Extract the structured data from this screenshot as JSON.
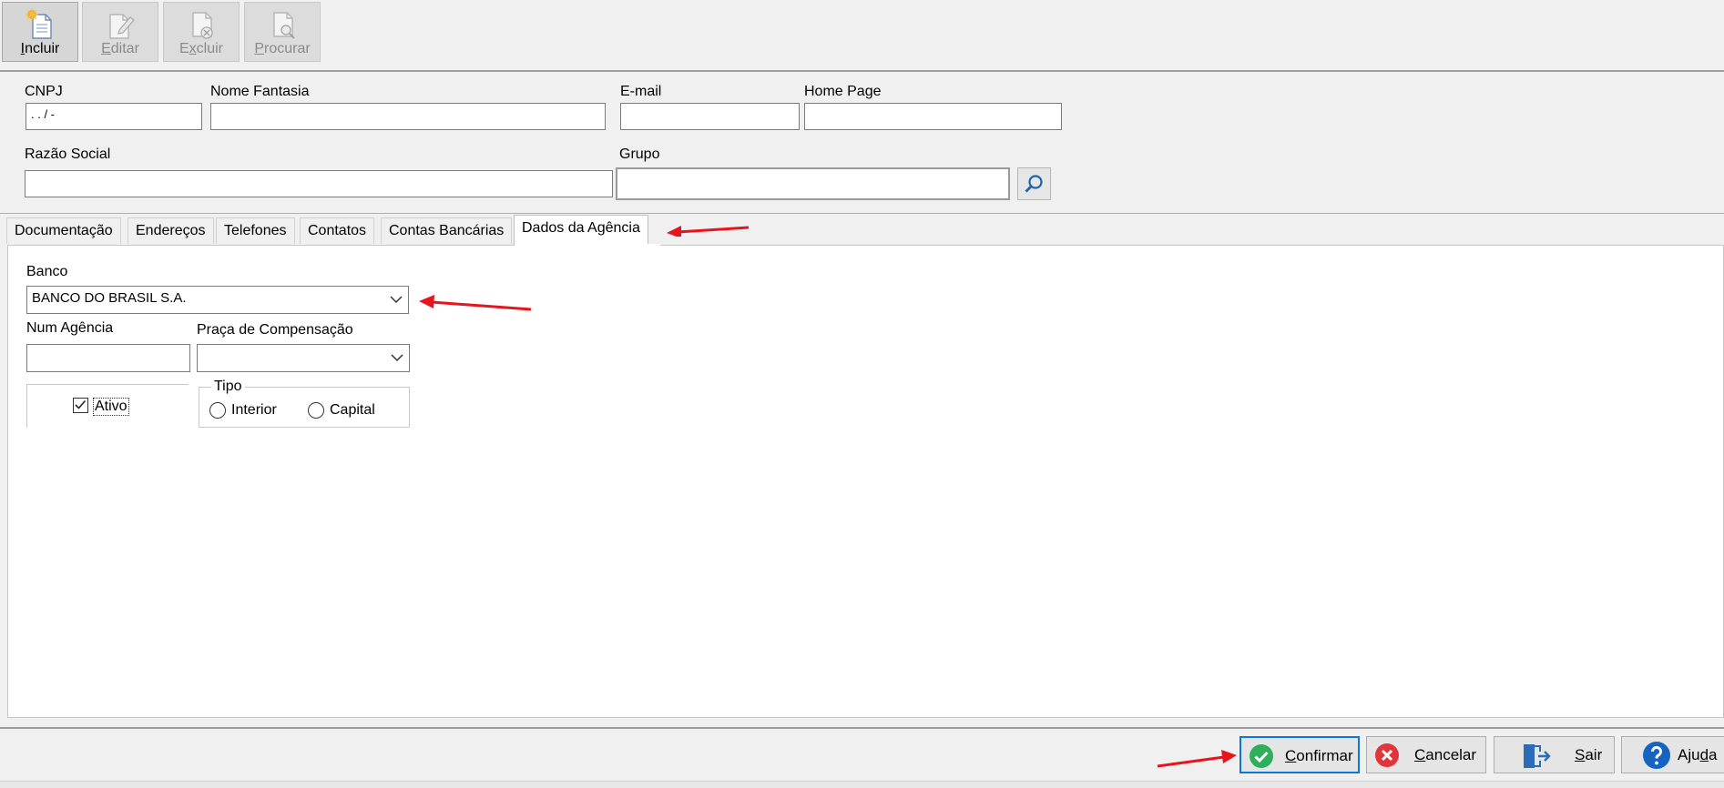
{
  "toolbar": {
    "buttons": [
      {
        "label": "Incluir",
        "hotkey": "I",
        "rest": "ncluir",
        "enabled": true
      },
      {
        "label": "Editar",
        "hotkey": "E",
        "rest": "ditar",
        "enabled": false
      },
      {
        "label": "Excluir",
        "hotkey": "x",
        "pre": "E",
        "rest": "cluir",
        "enabled": false
      },
      {
        "label": "Procurar",
        "hotkey": "P",
        "rest": "rocurar",
        "enabled": false
      }
    ]
  },
  "form": {
    "cnpj_label": "CNPJ",
    "cnpj_value": " .   .   /    -",
    "nome_fantasia_label": "Nome Fantasia",
    "nome_fantasia_value": "",
    "email_label": "E-mail",
    "email_value": "",
    "home_page_label": "Home Page",
    "home_page_value": "",
    "razao_social_label": "Razão Social",
    "razao_social_value": "",
    "grupo_label": "Grupo",
    "grupo_value": ""
  },
  "tabs": [
    {
      "label": "Documentação",
      "active": false
    },
    {
      "label": "Endereços",
      "active": false
    },
    {
      "label": "Telefones",
      "active": false
    },
    {
      "label": "Contatos",
      "active": false
    },
    {
      "label": "Contas Bancárias",
      "active": false
    },
    {
      "label": "Dados da Agência",
      "active": true
    }
  ],
  "agencia": {
    "banco_label": "Banco",
    "banco_value": "BANCO DO BRASIL S.A.",
    "num_agencia_label": "Num Agência",
    "num_agencia_value": "",
    "praca_label": "Praça de Compensação",
    "praca_value": "",
    "ativo_label": "Ativo",
    "ativo_checked": true,
    "tipo_label": "Tipo",
    "tipo_options": [
      "Interior",
      "Capital"
    ],
    "tipo_selected": null
  },
  "footer": {
    "confirmar": {
      "hotkey": "C",
      "rest": "onfirmar"
    },
    "cancelar": {
      "hotkey": "C",
      "rest": "ancelar"
    },
    "sair": {
      "hotkey": "S",
      "rest": "air"
    },
    "ajuda": {
      "pre": "Aju",
      "hotkey": "d",
      "rest": "a"
    }
  },
  "colors": {
    "annotation_arrow": "#e8141c",
    "focus_border": "#0b78d7",
    "confirm_icon": "#2fae5c",
    "cancel_icon": "#e0363b",
    "help_icon": "#1565c0",
    "exit_icon": "#2b6cb8"
  },
  "icons": {
    "incluir": "new-document-icon",
    "editar": "edit-document-icon",
    "excluir": "delete-document-icon",
    "procurar": "search-document-icon",
    "grupo_search": "magnifier-icon",
    "confirmar": "check-circle-icon",
    "cancelar": "x-circle-icon",
    "sair": "exit-door-icon",
    "ajuda": "question-circle-icon"
  }
}
